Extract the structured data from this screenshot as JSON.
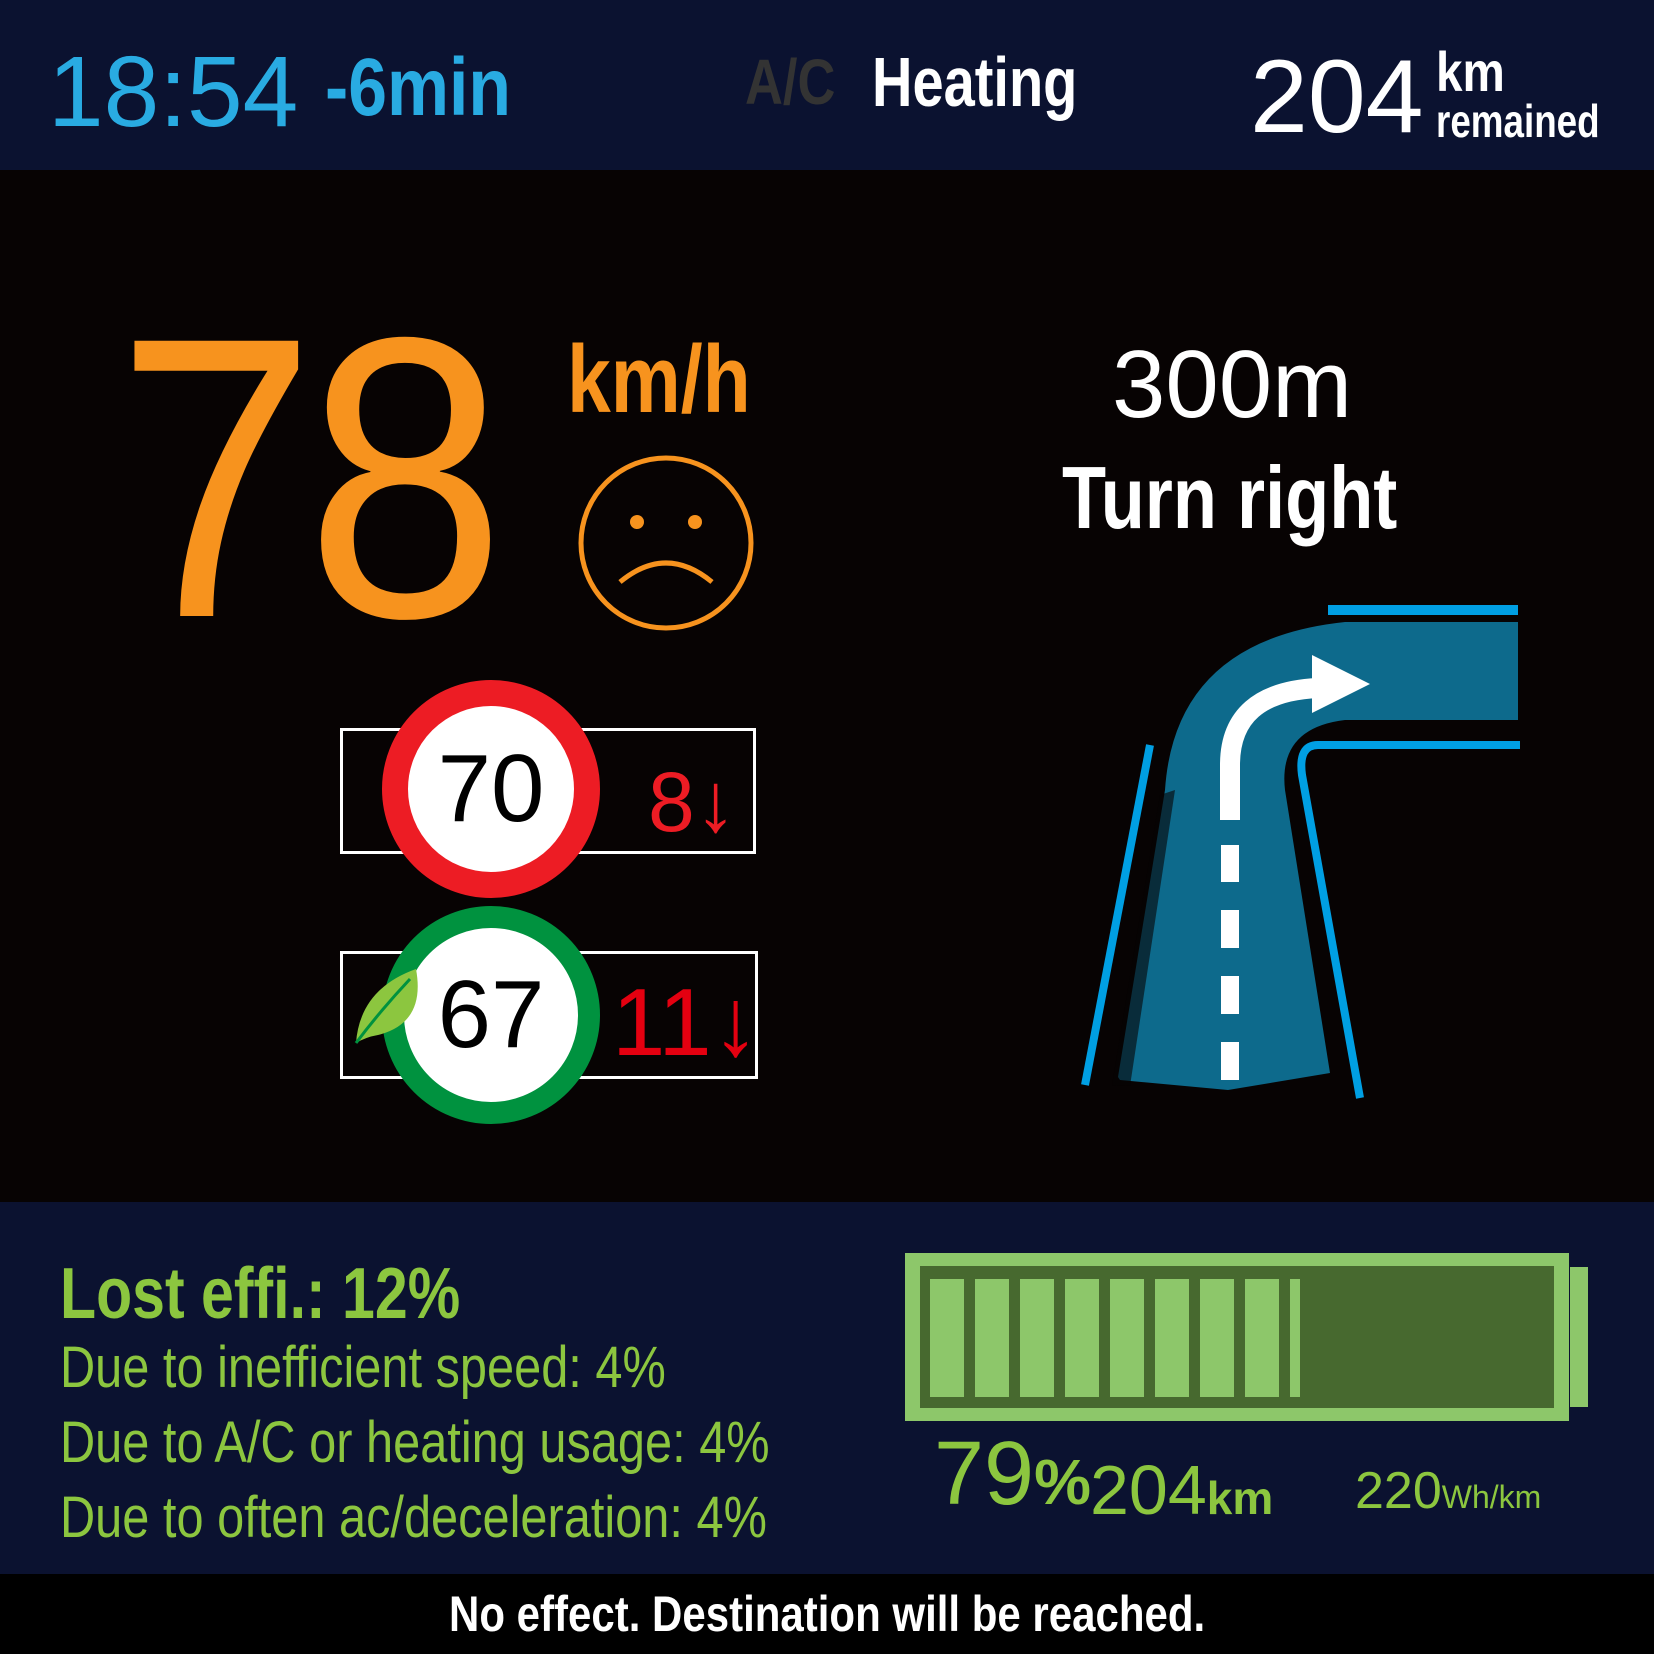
{
  "header": {
    "clock": "18:54",
    "eta_delta": "-6min",
    "ac_label": "A/C",
    "climate_mode": "Heating",
    "range_value": "204",
    "range_unit": "km",
    "range_suffix": "remained"
  },
  "speed": {
    "value": "78",
    "unit": "km/h",
    "mood_icon": "sad-face-icon"
  },
  "speed_limit": {
    "value": "70",
    "excess": "8↓"
  },
  "eco_speed": {
    "value": "67",
    "excess": "11↓",
    "icon": "leaf-icon"
  },
  "navigation": {
    "distance": "300m",
    "instruction": "Turn right",
    "icon": "turn-right-icon"
  },
  "efficiency": {
    "title": "Lost effi.: 12%",
    "reasons": [
      "Due to inefficient speed: 4%",
      "Due to A/C or heating usage: 4%",
      "Due to often ac/deceleration: 4%"
    ]
  },
  "battery": {
    "level": 0.79,
    "percent_value": "79",
    "percent_unit": "%",
    "range_value": "204",
    "range_unit": "km",
    "consumption_value": "220",
    "consumption_unit": "Wh/km"
  },
  "footer": {
    "message": "No effect. Destination will be reached."
  },
  "colors": {
    "header_bg": "#0b1230",
    "time_blue": "#29abe2",
    "speed_orange": "#f7931e",
    "limit_red": "#ed1c24",
    "eco_green": "#00923f",
    "efficiency_green": "#8cc63f",
    "road_blue": "#0d6a8c",
    "lane_blue": "#009fe3"
  }
}
